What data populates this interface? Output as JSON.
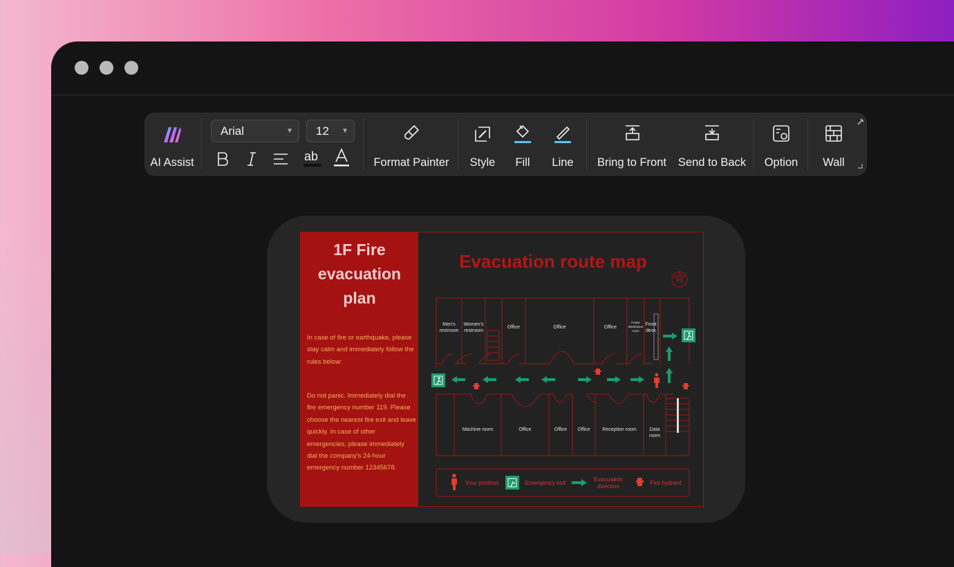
{
  "toolbar": {
    "ai_assist": "AI Assist",
    "font_family": "Arial",
    "font_size": "12",
    "format_painter": "Format Painter",
    "style": "Style",
    "fill": "Fill",
    "line": "Line",
    "bring_to_front": "Bring to Front",
    "send_to_back": "Send to Back",
    "option": "Option",
    "wall": "Wall"
  },
  "plan": {
    "title_line1": "1F Fire",
    "title_line2": "evacuation",
    "title_line3": "plan",
    "intro": "In case of fire or earthquake, please stay calm and immediately follow the rules below:",
    "rules": "Do not panic. Immediately dial the fire emergency number 119. Please choose the nearest fire exit and leave quickly. In case of other emergencies, please immediately dial the company's 24-hour emergency number 12345678.",
    "map_title": "Evacuation route map",
    "rooms_top": {
      "mens": "Men's restroom",
      "womens": "Women's restroom",
      "office1": "Office",
      "office2": "Office",
      "office3": "Office",
      "power": "Power distribution room",
      "front_desk": "Front desk"
    },
    "rooms_bottom": {
      "machine": "Machine room",
      "office1": "Office",
      "office2": "Office",
      "office3": "Office",
      "reception": "Reception room",
      "data": "Data room"
    },
    "legend": {
      "position": "Your position",
      "exit": "Emergency exit",
      "direction": "Evacuation direction",
      "hydrant": "Fire hydrant"
    }
  },
  "colors": {
    "accent_red": "#a51212",
    "exit_green": "#1f9a6e",
    "text_orange": "#f1b25a"
  }
}
